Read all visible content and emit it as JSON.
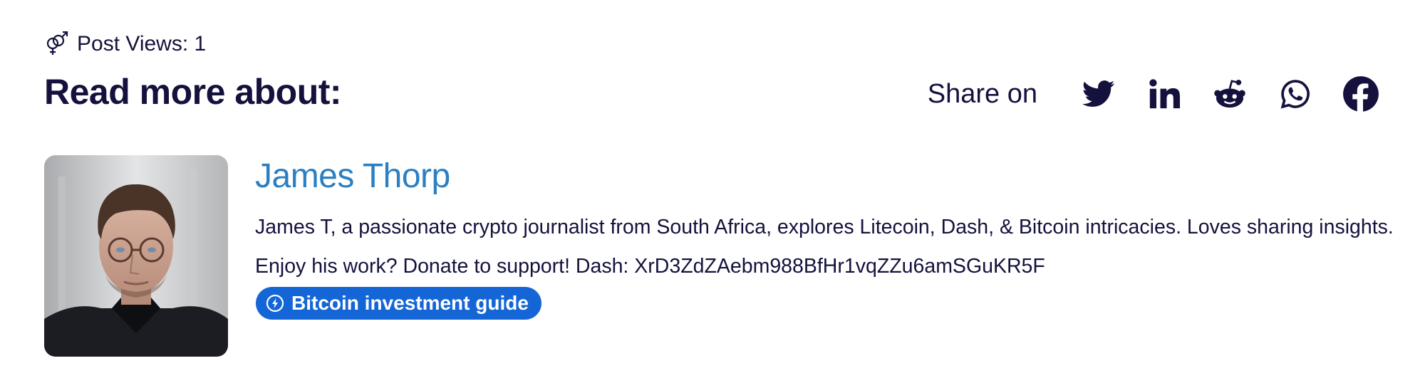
{
  "post_views": {
    "icon": "gender-symbol-icon",
    "text": "Post Views: 1"
  },
  "read_more": {
    "heading": "Read more about:"
  },
  "share": {
    "label": "Share on",
    "icons": [
      "twitter-icon",
      "linkedin-icon",
      "reddit-icon",
      "whatsapp-icon",
      "facebook-icon"
    ],
    "icon_color": "#14123d"
  },
  "author": {
    "name": "James Thorp",
    "bio": "James T, a passionate crypto journalist from South Africa, explores Litecoin, Dash, & Bitcoin intricacies. Loves sharing insights. Enjoy his work? Donate to support! Dash: XrD3ZdZAebm988BfHr1vqZZu6amSGuKR5F",
    "avatar_icon": "author-avatar",
    "name_color": "#2b7fc2"
  },
  "tag": {
    "label": "Bitcoin investment guide",
    "icon": "bolt-circle-icon",
    "background": "#1466d6"
  }
}
